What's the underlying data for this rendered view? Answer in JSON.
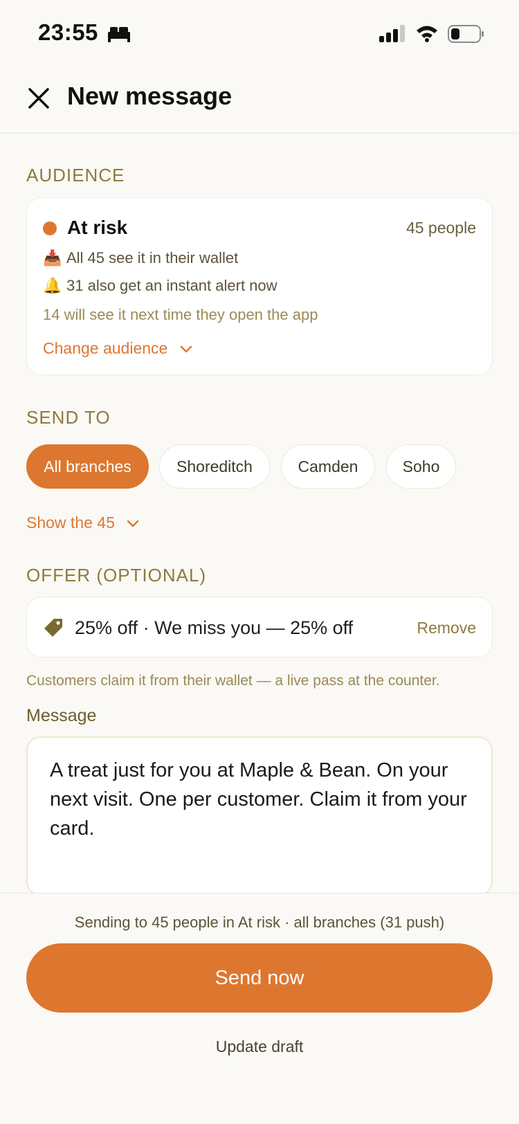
{
  "status_bar": {
    "time": "23:55"
  },
  "header": {
    "title": "New message"
  },
  "audience": {
    "section_label": "AUDIENCE",
    "segment_name": "At risk",
    "segment_count": "45 people",
    "wallet_line": "All 45 see it in their wallet",
    "alert_line": "31 also get an instant alert now",
    "later_line": "14 will see it next time they open the app",
    "change_label": "Change audience",
    "wallet_emoji": "📥",
    "bell_emoji": "🔔",
    "dot_color": "#dd7730"
  },
  "send_to": {
    "section_label": "SEND TO",
    "chips": [
      "All branches",
      "Shoreditch",
      "Camden",
      "Soho"
    ],
    "selected": "All branches",
    "show_label": "Show the 45"
  },
  "offer": {
    "section_label": "OFFER (OPTIONAL)",
    "text": "25% off · We miss you — 25% off",
    "remove_label": "Remove",
    "note": "Customers claim it from their wallet — a live pass at the counter."
  },
  "message": {
    "label": "Message",
    "body": "A treat just for you at Maple & Bean. On your next visit. One per customer. Claim it from your card."
  },
  "footer": {
    "summary": "Sending to 45 people in At risk · all branches (31 push)",
    "send_label": "Send now",
    "draft_label": "Update draft"
  },
  "colors": {
    "accent": "#dd7730",
    "label": "#8c7a3f",
    "background": "#faf9f5"
  }
}
